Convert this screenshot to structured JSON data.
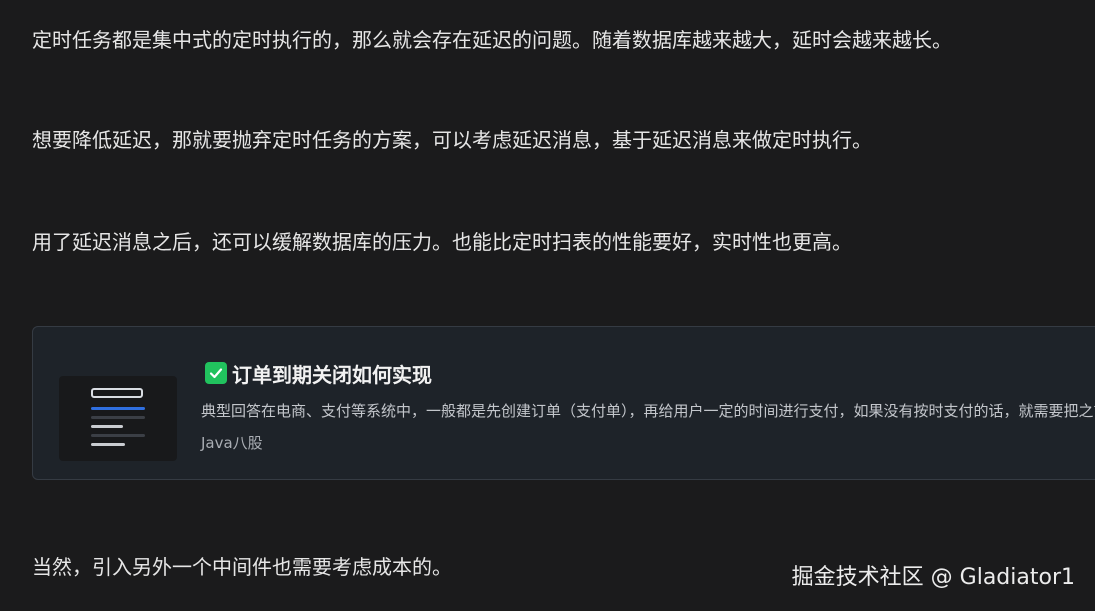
{
  "article": {
    "paragraphs": [
      "定时任务都是集中式的定时执行的，那么就会存在延迟的问题。随着数据库越来越大，延时会越来越长。",
      "想要降低延迟，那就要抛弃定时任务的方案，可以考虑延迟消息，基于延迟消息来做定时执行。",
      "用了延迟消息之后，还可以缓解数据库的压力。也能比定时扫表的性能要好，实时性也更高。",
      "当然，引入另外一个中间件也需要考虑成本的。"
    ]
  },
  "link_card": {
    "title": "订单到期关闭如何实现",
    "title_icon": "check-mark-icon",
    "description": "典型回答在电商、支付等系统中，一般都是先创建订单（支付单），再给用户一定的时间进行支付，如果没有按时支付的话，就需要把之前的订单取消掉。",
    "source": "Java八股",
    "icon_color": "#21c25e"
  },
  "watermark": {
    "text": "掘金技术社区 @ Gladiator1"
  }
}
